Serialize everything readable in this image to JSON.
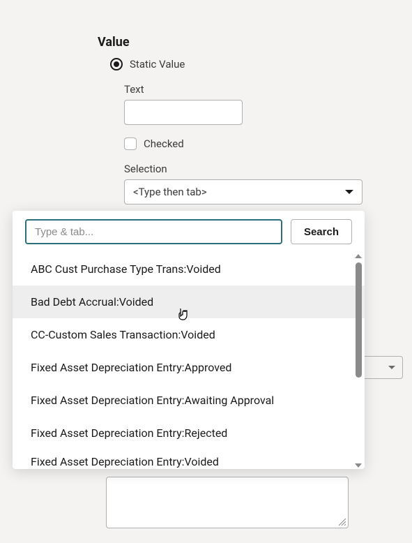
{
  "section": {
    "title": "Value",
    "radio": {
      "label": "Static Value"
    },
    "text_field": {
      "label": "Text",
      "value": ""
    },
    "checkbox": {
      "label": "Checked"
    },
    "selection_field": {
      "label": "Selection",
      "placeholder": "<Type then tab>"
    }
  },
  "popover": {
    "search_placeholder": "Type & tab...",
    "search_button": "Search",
    "options": [
      "ABC Cust Purchase Type Trans:Voided",
      "Bad Debt Accrual:Voided",
      "CC-Custom Sales Transaction:Voided",
      "Fixed Asset Depreciation Entry:Approved",
      "Fixed Asset Depreciation Entry:Awaiting Approval",
      "Fixed Asset Depreciation Entry:Rejected",
      "Fixed Asset Depreciation Entry:Voided"
    ],
    "hovered_index": 1
  }
}
